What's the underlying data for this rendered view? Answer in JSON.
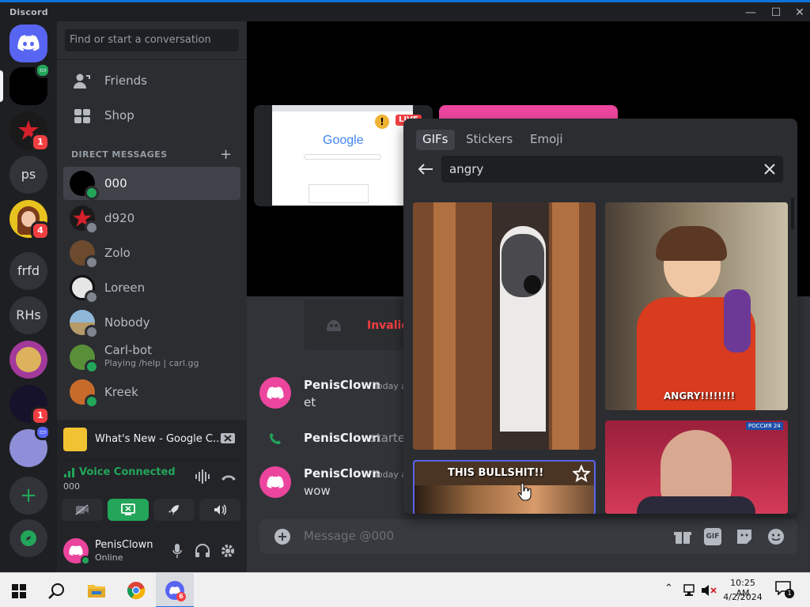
{
  "window": {
    "title": "Discord",
    "minimize": "—",
    "maximize": "☐",
    "close": "✕"
  },
  "servers": {
    "items": [
      {
        "label": "",
        "badge": ""
      },
      {
        "label": "",
        "badge": ""
      },
      {
        "label": "",
        "badge": "1"
      },
      {
        "label": "ps",
        "badge": ""
      },
      {
        "label": "",
        "badge": "4"
      },
      {
        "label": "frfd",
        "badge": ""
      },
      {
        "label": "RHs",
        "badge": ""
      },
      {
        "label": "",
        "badge": ""
      },
      {
        "label": "",
        "badge": "1"
      },
      {
        "label": "",
        "badge": ""
      }
    ],
    "add": "+"
  },
  "sidebar": {
    "search_placeholder": "Find or start a conversation",
    "friends": "Friends",
    "shop": "Shop",
    "dm_header": "DIRECT MESSAGES",
    "dm_add": "+",
    "dms": [
      {
        "name": "000",
        "sub": ""
      },
      {
        "name": "d920",
        "sub": ""
      },
      {
        "name": "Zolo",
        "sub": ""
      },
      {
        "name": "Loreen",
        "sub": ""
      },
      {
        "name": "Nobody",
        "sub": ""
      },
      {
        "name": "Carl-bot",
        "sub": "Playing /help | carl.gg"
      },
      {
        "name": "Kreek",
        "sub": ""
      }
    ],
    "activity_title": "What's New - Google C...",
    "voice_status": "Voice Connected",
    "voice_channel": "000",
    "user_name": "PenisClown",
    "user_status": "Online"
  },
  "main": {
    "stream_live": "LIVE",
    "google_text": "Google",
    "invalid_text": "Invalid",
    "messages": [
      {
        "author": "PenisClown",
        "time": "Today a",
        "text": "et"
      },
      {
        "author": "PenisClown",
        "system": "starte"
      },
      {
        "author": "PenisClown",
        "time": "Today a",
        "text": "wow"
      }
    ],
    "composer_placeholder": "Message @000",
    "gif_button": "GIF"
  },
  "gif_picker": {
    "tabs": [
      "GIFs",
      "Stickers",
      "Emoji"
    ],
    "query": "angry",
    "captions": [
      "ANGRY!!!!!!!!",
      "THIS BULLSHIT!!"
    ],
    "watermark": "РОССИЯ 24"
  },
  "taskbar": {
    "time": "10:25 AM",
    "date": "4/2/2024",
    "discord_badge": "6",
    "notif_count": "1"
  }
}
